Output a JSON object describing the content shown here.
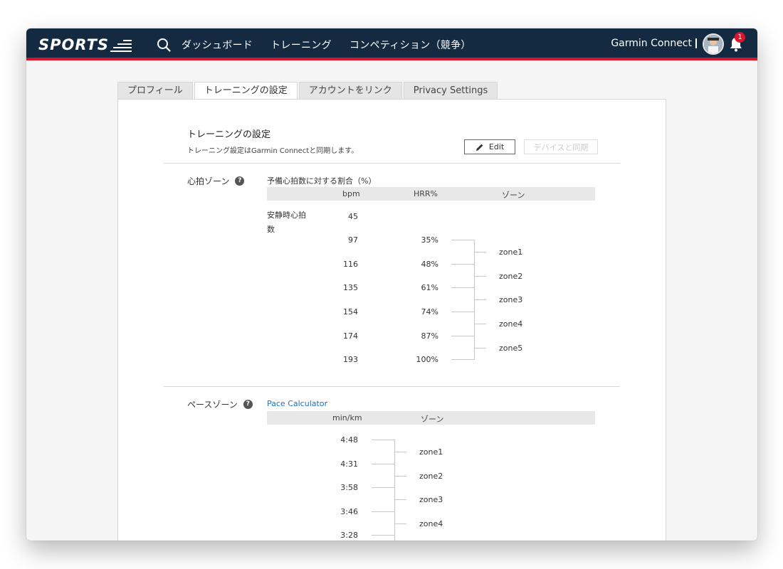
{
  "header": {
    "logo_text": "SPORTS",
    "nav": [
      "ダッシュボード",
      "トレーニング",
      "コンペティション（競争）"
    ],
    "account_name": "Garmin Connect",
    "notification_count": "1"
  },
  "tabs": [
    "プロフィール",
    "トレーニングの設定",
    "アカウントをリンク",
    "Privacy Settings"
  ],
  "section": {
    "title": "トレーニングの設定",
    "subtitle": "トレーニング設定はGarmin Connectと同期します。",
    "edit_label": "Edit",
    "sync_label": "デバイスと同期"
  },
  "heart": {
    "label": "心拍ゾーン",
    "help": "?",
    "method": "予備心拍数に対する割合（%）",
    "col_bpm": "bpm",
    "col_hrr": "HRR%",
    "col_zone": "ゾーン",
    "resting_label_1": "安静時心拍",
    "resting_label_2": "数",
    "resting_value": "45",
    "rows": [
      {
        "bpm": "97",
        "hrr": "35%"
      },
      {
        "bpm": "116",
        "hrr": "48%"
      },
      {
        "bpm": "135",
        "hrr": "61%"
      },
      {
        "bpm": "154",
        "hrr": "74%"
      },
      {
        "bpm": "174",
        "hrr": "87%"
      },
      {
        "bpm": "193",
        "hrr": "100%"
      }
    ],
    "zones": [
      "zone1",
      "zone2",
      "zone3",
      "zone4",
      "zone5"
    ]
  },
  "pace": {
    "label": "ペースゾーン",
    "help": "?",
    "calculator_link": "Pace Calculator",
    "col_minkm": "min/km",
    "col_zone": "ゾーン",
    "rows": [
      "4:48",
      "4:31",
      "3:58",
      "3:46",
      "3:28"
    ],
    "zones": [
      "zone1",
      "zone2",
      "zone3",
      "zone4"
    ]
  }
}
